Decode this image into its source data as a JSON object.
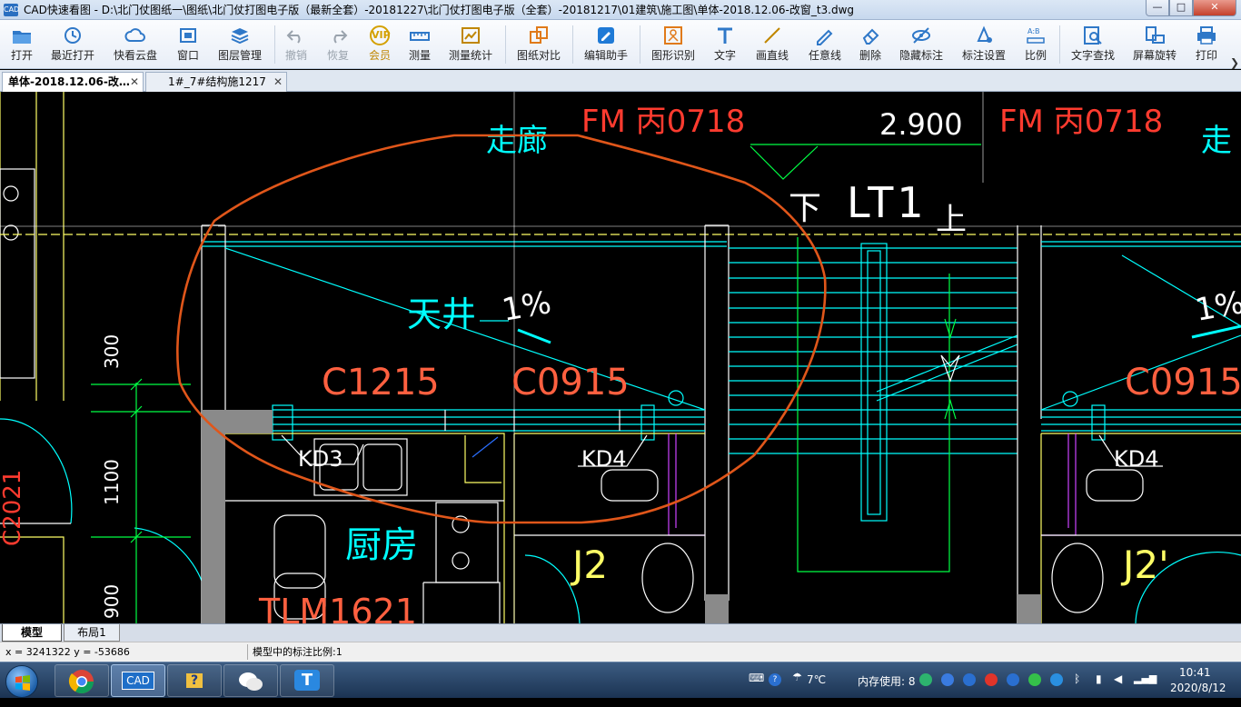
{
  "window": {
    "app_icon": "CAD",
    "title": "CAD快速看图 - D:\\北门仗图纸一\\图纸\\北门仗打图电子版（最新全套）-20181227\\北门仗打图电子版（全套）-20181217\\01建筑\\施工图\\单体-2018.12.06-改窗_t3.dwg",
    "min": "—",
    "max": "□",
    "close": "✕"
  },
  "toolbar": {
    "items": [
      {
        "label": "打开",
        "icon": "folder-icon"
      },
      {
        "label": "最近打开",
        "icon": "recent-icon"
      },
      {
        "label": "快看云盘",
        "icon": "cloud-icon"
      },
      {
        "label": "窗口",
        "icon": "window-icon"
      },
      {
        "label": "图层管理",
        "icon": "layers-icon"
      },
      {
        "label": "撤销",
        "icon": "undo-icon"
      },
      {
        "label": "恢复",
        "icon": "redo-icon"
      },
      {
        "label": "会员",
        "icon": "vip-icon"
      },
      {
        "label": "测量",
        "icon": "measure-icon"
      },
      {
        "label": "测量统计",
        "icon": "measure-stats-icon"
      },
      {
        "label": "图纸对比",
        "icon": "compare-icon"
      },
      {
        "label": "编辑助手",
        "icon": "edit-helper-icon"
      },
      {
        "label": "图形识别",
        "icon": "shape-recognize-icon"
      },
      {
        "label": "文字",
        "icon": "text-icon"
      },
      {
        "label": "画直线",
        "icon": "line-icon"
      },
      {
        "label": "任意线",
        "icon": "freehand-icon"
      },
      {
        "label": "删除",
        "icon": "eraser-icon"
      },
      {
        "label": "隐藏标注",
        "icon": "hide-annotation-icon"
      },
      {
        "label": "标注设置",
        "icon": "annotation-settings-icon"
      },
      {
        "label": "比例",
        "icon": "scale-icon"
      },
      {
        "label": "文字查找",
        "icon": "text-search-icon"
      },
      {
        "label": "屏幕旋转",
        "icon": "rotate-screen-icon"
      },
      {
        "label": "打印",
        "icon": "print-icon"
      }
    ],
    "vip_glyph": "VIP",
    "more": "❯"
  },
  "tabs": [
    {
      "label": "单体-2018.12.06-改…",
      "close": "✕"
    },
    {
      "label": "1#_7#结构施1217",
      "close": "✕"
    }
  ],
  "drawing": {
    "texts": {
      "corridor": "走廊",
      "corridor_right": "走",
      "fm_left": "FM 丙0718",
      "fm_right": "FM 丙0718",
      "elevation": "2.900",
      "stair_down": "下",
      "lt1": "LT1",
      "stair_up": "上",
      "patio": "天井",
      "slope_left": "1%",
      "slope_right": "1%",
      "c1215": "C1215",
      "c0915_left": "C0915",
      "c0915_right": "C0915",
      "kd3": "KD3",
      "kd4_left": "KD4",
      "kd4_right": "KD4",
      "kitchen": "厨房",
      "tlm": "TLM1621",
      "j2": "J2",
      "j2_right": "J2'",
      "dim_300": "300",
      "dim_1100": "1100",
      "dim_900": "900",
      "c2021": "C2021"
    },
    "colors": {
      "background": "#000000",
      "wall_white": "#ffffff",
      "cyan": "#00ffff",
      "yellow": "#ffff66",
      "green": "#00ff44",
      "red": "#ff3b2f",
      "annotation_orange": "#e0561a",
      "magenta": "#cc44ff",
      "gray_column": "#8a8a8a"
    }
  },
  "layout_tabs": [
    {
      "label": "模型"
    },
    {
      "label": "布局1"
    }
  ],
  "status": {
    "coords": "x = 3241322  y = -53686",
    "scale_text": "模型中的标注比例:1"
  },
  "taskbar": {
    "buttons": [
      {
        "label": "",
        "icon": "chrome-icon"
      },
      {
        "label": "CAD",
        "icon": "cad-icon"
      },
      {
        "label": "?",
        "icon": "help-folder-icon"
      },
      {
        "label": "",
        "icon": "wechat-icon"
      },
      {
        "label": "T",
        "icon": "text-app-icon"
      }
    ],
    "weather": "7℃",
    "memory": "内存使用: 8",
    "time": "10:41",
    "date": "2020/8/12"
  }
}
